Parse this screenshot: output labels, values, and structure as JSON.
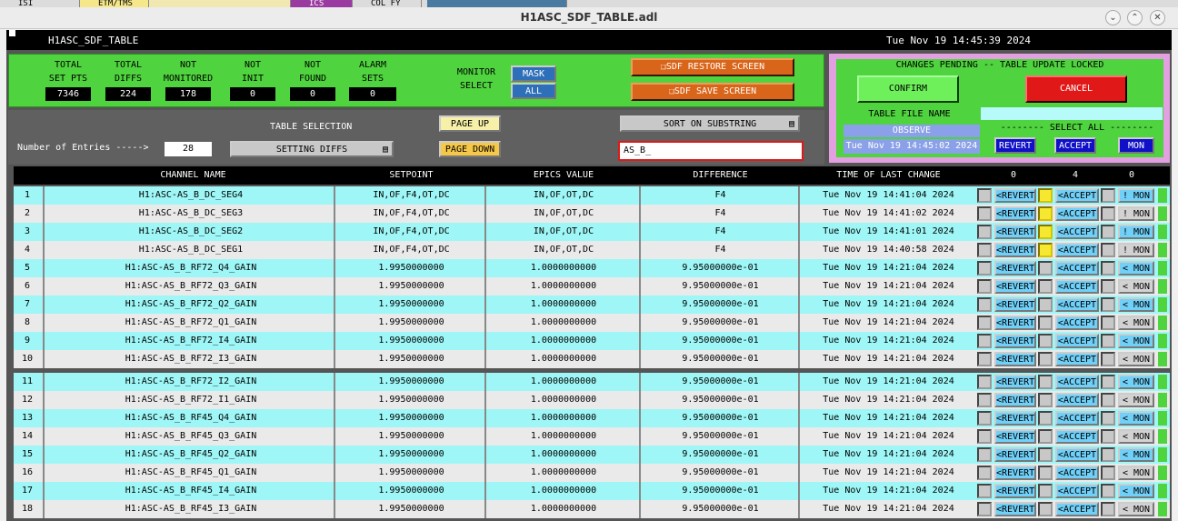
{
  "bg_tabs": [
    "ISI",
    "ETM/TMS",
    "",
    "ICS",
    "COL FY"
  ],
  "window": {
    "title": "H1ASC_SDF_TABLE.adl"
  },
  "header": {
    "name": "H1ASC_SDF_TABLE",
    "datetime": "Tue Nov 19 14:45:39 2024"
  },
  "stats": [
    {
      "label1": "TOTAL",
      "label2": "SET PTS",
      "value": "7346"
    },
    {
      "label1": "TOTAL",
      "label2": "DIFFS",
      "value": "224"
    },
    {
      "label1": "NOT",
      "label2": "MONITORED",
      "value": "178"
    },
    {
      "label1": "NOT",
      "label2": "INIT",
      "value": "0"
    },
    {
      "label1": "NOT",
      "label2": "FOUND",
      "value": "0"
    },
    {
      "label1": "ALARM",
      "label2": "SETS",
      "value": "0"
    }
  ],
  "monitor": {
    "label1": "MONITOR",
    "label2": "SELECT",
    "mask": "MASK",
    "all": "ALL"
  },
  "actions": {
    "restore": "SDF RESTORE SCREEN",
    "save": "SDF SAVE SCREEN"
  },
  "pending": {
    "title": "CHANGES PENDING -- TABLE UPDATE LOCKED",
    "confirm": "CONFIRM",
    "cancel": "CANCEL",
    "file_label": "TABLE FILE NAME",
    "observe": "OBSERVE",
    "file_time": "Tue Nov 19 14:45:02 2024",
    "select_all": "-------- SELECT ALL --------",
    "revert": "REVERT",
    "accept": "ACCEPT",
    "mon": "MON"
  },
  "controls": {
    "entries_label": "Number of Entries ----->",
    "entries": "28",
    "table_selection": "TABLE SELECTION",
    "setting": "SETTING DIFFS",
    "page_up": "PAGE UP",
    "page_down": "PAGE DOWN",
    "sort": "SORT ON SUBSTRING",
    "substring": "AS_B_"
  },
  "table": {
    "headers": [
      "CHANNEL NAME",
      "SETPOINT",
      "EPICS VALUE",
      "DIFFERENCE",
      "TIME OF LAST CHANGE",
      "0",
      "4",
      "0"
    ],
    "rows": [
      {
        "n": "1",
        "ch": "H1:ASC-AS_B_DC_SEG4",
        "sp": "IN,OF,F4,OT,DC",
        "ev": "IN,OF,OT,DC",
        "df": "F4",
        "t": "Tue Nov 19 14:41:04 2024",
        "rev": "<REVERT",
        "acc": "<ACCEPT",
        "mon": "! MON",
        "y": true
      },
      {
        "n": "2",
        "ch": "H1:ASC-AS_B_DC_SEG3",
        "sp": "IN,OF,F4,OT,DC",
        "ev": "IN,OF,OT,DC",
        "df": "F4",
        "t": "Tue Nov 19 14:41:02 2024",
        "rev": "<REVERT",
        "acc": "<ACCEPT",
        "mon": "! MON",
        "y": true
      },
      {
        "n": "3",
        "ch": "H1:ASC-AS_B_DC_SEG2",
        "sp": "IN,OF,F4,OT,DC",
        "ev": "IN,OF,OT,DC",
        "df": "F4",
        "t": "Tue Nov 19 14:41:01 2024",
        "rev": "<REVERT",
        "acc": "<ACCEPT",
        "mon": "! MON",
        "y": true
      },
      {
        "n": "4",
        "ch": "H1:ASC-AS_B_DC_SEG1",
        "sp": "IN,OF,F4,OT,DC",
        "ev": "IN,OF,OT,DC",
        "df": "F4",
        "t": "Tue Nov 19 14:40:58 2024",
        "rev": "<REVERT",
        "acc": "<ACCEPT",
        "mon": "! MON",
        "y": true
      },
      {
        "n": "5",
        "ch": "H1:ASC-AS_B_RF72_Q4_GAIN",
        "sp": "1.9950000000",
        "ev": "1.0000000000",
        "df": "9.95000000e-01",
        "t": "Tue Nov 19 14:21:04 2024",
        "rev": "<REVERT",
        "acc": "<ACCEPT",
        "mon": "< MON",
        "y": false
      },
      {
        "n": "6",
        "ch": "H1:ASC-AS_B_RF72_Q3_GAIN",
        "sp": "1.9950000000",
        "ev": "1.0000000000",
        "df": "9.95000000e-01",
        "t": "Tue Nov 19 14:21:04 2024",
        "rev": "<REVERT",
        "acc": "<ACCEPT",
        "mon": "< MON",
        "y": false
      },
      {
        "n": "7",
        "ch": "H1:ASC-AS_B_RF72_Q2_GAIN",
        "sp": "1.9950000000",
        "ev": "1.0000000000",
        "df": "9.95000000e-01",
        "t": "Tue Nov 19 14:21:04 2024",
        "rev": "<REVERT",
        "acc": "<ACCEPT",
        "mon": "< MON",
        "y": false
      },
      {
        "n": "8",
        "ch": "H1:ASC-AS_B_RF72_Q1_GAIN",
        "sp": "1.9950000000",
        "ev": "1.0000000000",
        "df": "9.95000000e-01",
        "t": "Tue Nov 19 14:21:04 2024",
        "rev": "<REVERT",
        "acc": "<ACCEPT",
        "mon": "< MON",
        "y": false
      },
      {
        "n": "9",
        "ch": "H1:ASC-AS_B_RF72_I4_GAIN",
        "sp": "1.9950000000",
        "ev": "1.0000000000",
        "df": "9.95000000e-01",
        "t": "Tue Nov 19 14:21:04 2024",
        "rev": "<REVERT",
        "acc": "<ACCEPT",
        "mon": "< MON",
        "y": false
      },
      {
        "n": "10",
        "ch": "H1:ASC-AS_B_RF72_I3_GAIN",
        "sp": "1.9950000000",
        "ev": "1.0000000000",
        "df": "9.95000000e-01",
        "t": "Tue Nov 19 14:21:04 2024",
        "rev": "<REVERT",
        "acc": "<ACCEPT",
        "mon": "< MON",
        "y": false
      },
      {
        "n": "11",
        "ch": "H1:ASC-AS_B_RF72_I2_GAIN",
        "sp": "1.9950000000",
        "ev": "1.0000000000",
        "df": "9.95000000e-01",
        "t": "Tue Nov 19 14:21:04 2024",
        "rev": "<REVERT",
        "acc": "<ACCEPT",
        "mon": "< MON",
        "y": false
      },
      {
        "n": "12",
        "ch": "H1:ASC-AS_B_RF72_I1_GAIN",
        "sp": "1.9950000000",
        "ev": "1.0000000000",
        "df": "9.95000000e-01",
        "t": "Tue Nov 19 14:21:04 2024",
        "rev": "<REVERT",
        "acc": "<ACCEPT",
        "mon": "< MON",
        "y": false
      },
      {
        "n": "13",
        "ch": "H1:ASC-AS_B_RF45_Q4_GAIN",
        "sp": "1.9950000000",
        "ev": "1.0000000000",
        "df": "9.95000000e-01",
        "t": "Tue Nov 19 14:21:04 2024",
        "rev": "<REVERT",
        "acc": "<ACCEPT",
        "mon": "< MON",
        "y": false
      },
      {
        "n": "14",
        "ch": "H1:ASC-AS_B_RF45_Q3_GAIN",
        "sp": "1.9950000000",
        "ev": "1.0000000000",
        "df": "9.95000000e-01",
        "t": "Tue Nov 19 14:21:04 2024",
        "rev": "<REVERT",
        "acc": "<ACCEPT",
        "mon": "< MON",
        "y": false
      },
      {
        "n": "15",
        "ch": "H1:ASC-AS_B_RF45_Q2_GAIN",
        "sp": "1.9950000000",
        "ev": "1.0000000000",
        "df": "9.95000000e-01",
        "t": "Tue Nov 19 14:21:04 2024",
        "rev": "<REVERT",
        "acc": "<ACCEPT",
        "mon": "< MON",
        "y": false
      },
      {
        "n": "16",
        "ch": "H1:ASC-AS_B_RF45_Q1_GAIN",
        "sp": "1.9950000000",
        "ev": "1.0000000000",
        "df": "9.95000000e-01",
        "t": "Tue Nov 19 14:21:04 2024",
        "rev": "<REVERT",
        "acc": "<ACCEPT",
        "mon": "< MON",
        "y": false
      },
      {
        "n": "17",
        "ch": "H1:ASC-AS_B_RF45_I4_GAIN",
        "sp": "1.9950000000",
        "ev": "1.0000000000",
        "df": "9.95000000e-01",
        "t": "Tue Nov 19 14:21:04 2024",
        "rev": "<REVERT",
        "acc": "<ACCEPT",
        "mon": "< MON",
        "y": false
      },
      {
        "n": "18",
        "ch": "H1:ASC-AS_B_RF45_I3_GAIN",
        "sp": "1.9950000000",
        "ev": "1.0000000000",
        "df": "9.95000000e-01",
        "t": "Tue Nov 19 14:21:04 2024",
        "rev": "<REVERT",
        "acc": "<ACCEPT",
        "mon": "< MON",
        "y": false
      }
    ]
  },
  "colors": {
    "green": "#4fd33e",
    "cyan": "#9ef6f6",
    "gray": "#eaeaea",
    "orange": "#d9651a",
    "red": "#e01818",
    "mask_blue": "#2d6fb8",
    "dark_blue": "#1010c8"
  }
}
